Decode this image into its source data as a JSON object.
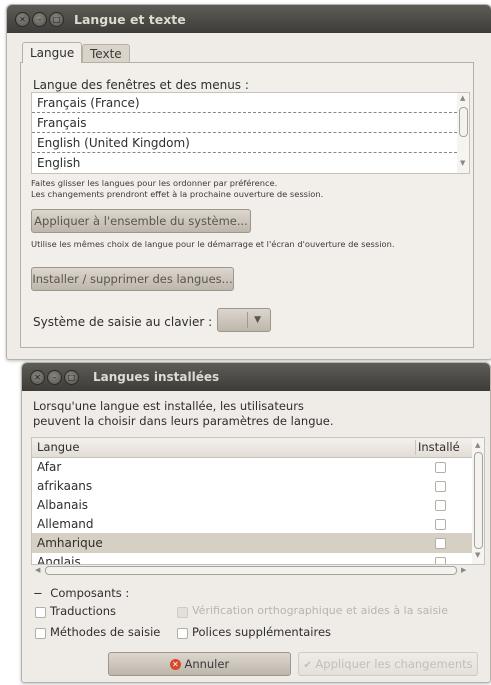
{
  "win1": {
    "title": "Langue et texte",
    "tabs": [
      "Langue",
      "Texte"
    ],
    "menu_lang_label": "Langue des fenêtres et des menus :",
    "languages": [
      "Français (France)",
      "Français",
      "English (United Kingdom)",
      "English"
    ],
    "hint1": "Faites glisser les langues pour les ordonner par préférence.",
    "hint2": "Les changements prendront effet à la prochaine ouverture de session.",
    "apply_system_button": "Appliquer à l'ensemble du système...",
    "same_choice_hint": "Utilise les mêmes choix de langue pour le démarrage et l'écran d'ouverture de session.",
    "install_button": "Installer / supprimer des langues...",
    "keyboard_input_label": "Système de saisie au clavier :"
  },
  "win2": {
    "title": "Langues installées",
    "intro_line1": "Lorsqu'une langue est installée, les utilisateurs",
    "intro_line2": "peuvent la choisir dans leurs paramètres de langue.",
    "col_language": "Langue",
    "col_installed": "Installé",
    "rows": [
      {
        "name": "Afar"
      },
      {
        "name": "afrikaans"
      },
      {
        "name": "Albanais"
      },
      {
        "name": "Allemand"
      },
      {
        "name": "Amharique"
      },
      {
        "name": "Anglais"
      }
    ],
    "selected_row": "Amharique",
    "components_label": "Composants :",
    "comp_translations": "Traductions",
    "comp_spellcheck": "Vérification orthographique et aides à la saisie",
    "comp_input_methods": "Méthodes de saisie",
    "comp_fonts": "Polices supplémentaires",
    "cancel_button": "Annuler",
    "apply_button": "Appliquer les changements"
  },
  "colors": {
    "titlebar": "#4a4843",
    "window_bg": "#efebe7",
    "selection": "#d6cfc4",
    "cancel_icon": "#d9472b"
  }
}
